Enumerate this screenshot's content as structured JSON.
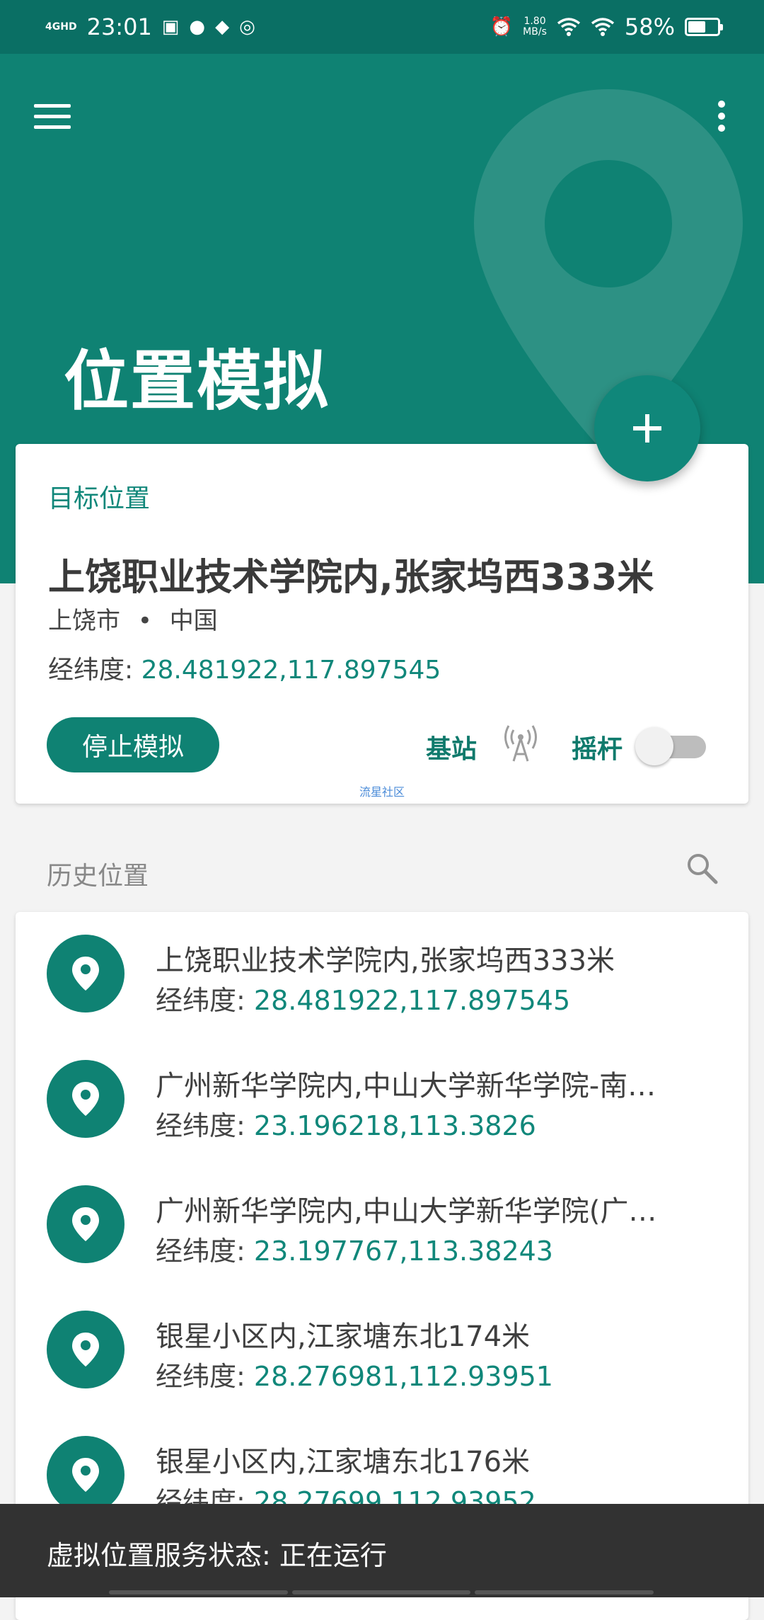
{
  "status_bar": {
    "network": "4GHD",
    "time": "23:01",
    "speed_value": "1.80",
    "speed_unit": "MB/s",
    "battery": "58%"
  },
  "header": {
    "title": "位置模拟"
  },
  "target": {
    "label": "目标位置",
    "name": "上饶职业技术学院内,张家坞西333米",
    "city": "上饶市",
    "separator": "•",
    "country": "中国",
    "coord_label": "经纬度:",
    "coords": "28.481922,117.897545",
    "stop_button": "停止模拟",
    "station_label": "基站",
    "joystick_label": "摇杆",
    "joystick_enabled": false,
    "watermark": "流星社区"
  },
  "history": {
    "title": "历史位置",
    "coord_label": "经纬度:",
    "items": [
      {
        "name": "上饶职业技术学院内,张家坞西333米",
        "coords": "28.481922,117.897545"
      },
      {
        "name": "广州新华学院内,中山大学新华学院-南…",
        "coords": "23.196218,113.3826"
      },
      {
        "name": "广州新华学院内,中山大学新华学院(广…",
        "coords": "23.197767,113.38243"
      },
      {
        "name": "银星小区内,江家塘东北174米",
        "coords": "28.276981,112.93951"
      },
      {
        "name": "银星小区内,江家塘东北176米",
        "coords": "28.27699,112.93952"
      }
    ]
  },
  "snackbar": {
    "text": "虚拟位置服务状态: 正在运行"
  },
  "colors": {
    "primary": "#0f8273",
    "primary_dark": "#0a6f64",
    "snackbar": "#323232"
  }
}
